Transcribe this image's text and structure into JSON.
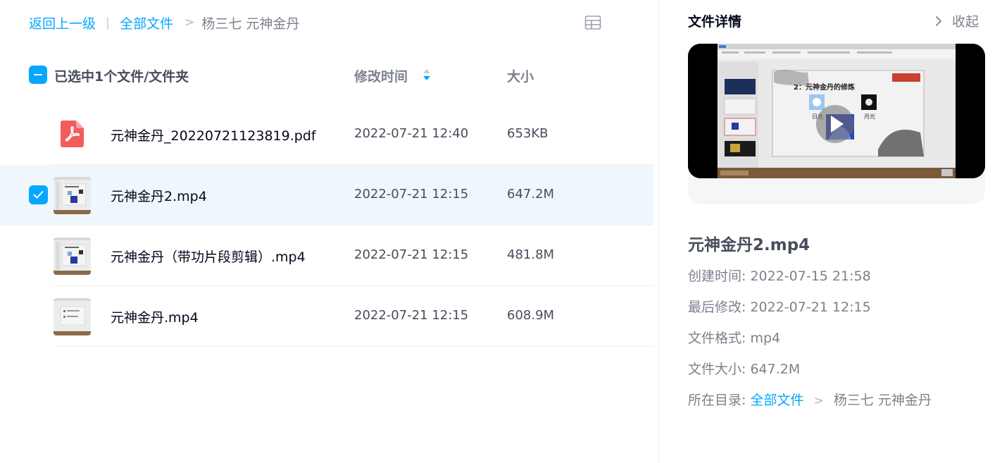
{
  "breadcrumb": {
    "back": "返回上一级",
    "separator": "|",
    "root": "全部文件",
    "arrow": ">",
    "current": "杨三七 元神金丹"
  },
  "list_header": {
    "selected_text": "已选中1个文件/文件夹",
    "modified_label": "修改时间",
    "size_label": "大小"
  },
  "files": [
    {
      "name": "元神金丹_20220721123819.pdf",
      "time": "2022-07-21 12:40",
      "size": "653KB",
      "type": "pdf",
      "selected": false
    },
    {
      "name": "元神金丹2.mp4",
      "time": "2022-07-21 12:15",
      "size": "647.2M",
      "type": "video",
      "selected": true
    },
    {
      "name": "元神金丹（带功片段剪辑）.mp4",
      "time": "2022-07-21 12:15",
      "size": "481.8M",
      "type": "video",
      "selected": false
    },
    {
      "name": "元神金丹.mp4",
      "time": "2022-07-21 12:15",
      "size": "608.9M",
      "type": "video",
      "selected": false
    }
  ],
  "details": {
    "title": "文件详情",
    "collapse_label": "收起",
    "file_name": "元神金丹2.mp4",
    "preview": {
      "slide_title": "2：元神金丹的修炼",
      "label_sun": "日光",
      "label_moon": "月光"
    },
    "created_label": "创建时间:",
    "created_value": "2022-07-15 21:58",
    "modified_label": "最后修改:",
    "modified_value": "2022-07-21 12:15",
    "format_label": "文件格式:",
    "format_value": "mp4",
    "size_label": "文件大小:",
    "size_value": "647.2M",
    "dir_label": "所在目录:",
    "dir_root": "全部文件",
    "dir_arrow": ">",
    "dir_current": "杨三七 元神金丹"
  },
  "colors": {
    "accent": "#06a7ff",
    "selected_row_bg": "#f0f7fc",
    "pdf_red": "#f25c5c",
    "text_primary": "#03081a",
    "text_secondary": "#7c818d"
  },
  "icons": {
    "layout": "grid-view-icon",
    "sort": "sort-arrows-icon",
    "check": "checkmark-icon",
    "pdf": "pdf-file-icon",
    "collapse": "chevron-right-icon",
    "play": "play-icon"
  }
}
